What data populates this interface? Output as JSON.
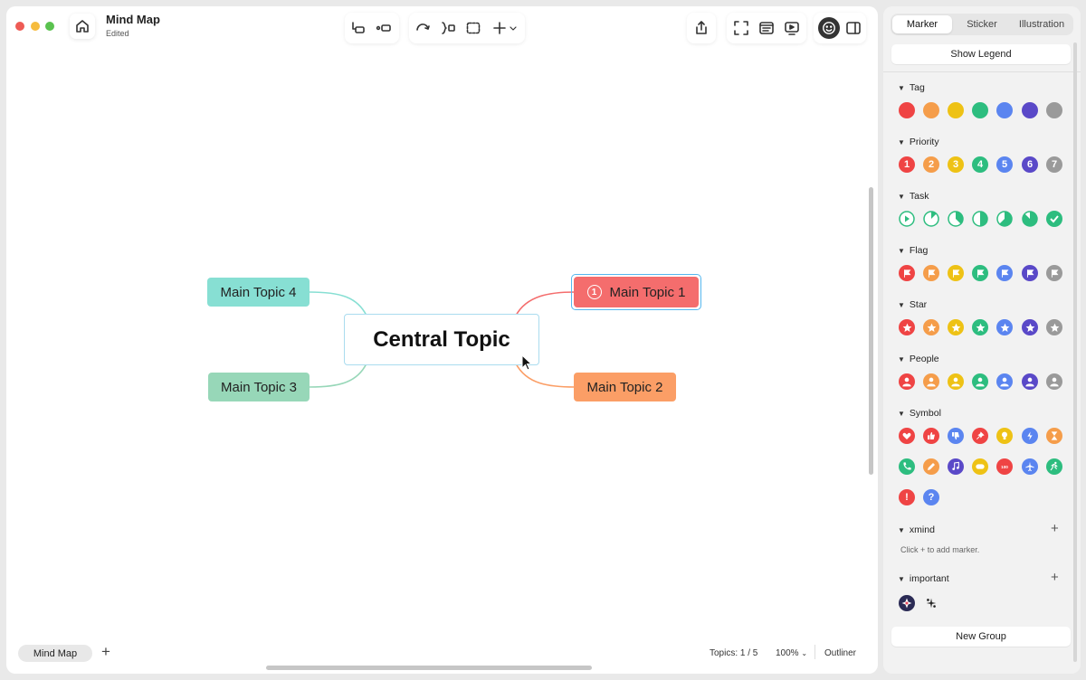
{
  "window": {
    "title": "Mind Map",
    "subtitle": "Edited"
  },
  "icons": {
    "home": "home-icon",
    "undo_group": [
      "topic-icon",
      "subtopic-icon"
    ],
    "relationship": "relationship-icon",
    "boundary": "boundary-icon",
    "summary": "summary-icon",
    "insert": "insert-icon",
    "share": "share-icon",
    "zen": "zen-mode-icon",
    "outline": "outline-icon",
    "present": "present-icon",
    "marker": "marker-icon",
    "panel_toggle": "panel-toggle-icon"
  },
  "map": {
    "central": "Central Topic",
    "topics": [
      {
        "label": "Main Topic 1",
        "color": "#f46d6d",
        "marker": "1"
      },
      {
        "label": "Main Topic 2",
        "color": "#fb9e66"
      },
      {
        "label": "Main Topic 3",
        "color": "#97d7b8"
      },
      {
        "label": "Main Topic 4",
        "color": "#87dfd3"
      }
    ]
  },
  "bottom": {
    "sheet_tab": "Mind Map",
    "add_sheet": "+",
    "topics_count": "Topics: 1 / 5",
    "zoom": "100%",
    "outliner": "Outliner"
  },
  "panel": {
    "tabs": [
      "Marker",
      "Sticker",
      "Illustration"
    ],
    "active_tab": "Marker",
    "show_legend": "Show Legend",
    "groups": [
      {
        "title": "Tag"
      },
      {
        "title": "Priority",
        "labels": [
          "1",
          "2",
          "3",
          "4",
          "5",
          "6",
          "7"
        ]
      },
      {
        "title": "Task"
      },
      {
        "title": "Flag"
      },
      {
        "title": "Star"
      },
      {
        "title": "People"
      },
      {
        "title": "Symbol"
      },
      {
        "title": "xmind",
        "hint": "Click + to add marker."
      },
      {
        "title": "important"
      }
    ],
    "plus": "+",
    "new_group": "New Group",
    "colors": [
      "#ef4444",
      "#f59d4a",
      "#eec215",
      "#2dbd7f",
      "#5b85f0",
      "#5a49c8",
      "#9a9a9a"
    ],
    "symbol_row1_colors": [
      "#ef4444",
      "#ef4444",
      "#5b85f0",
      "#ef4444",
      "#eec215",
      "#5b85f0",
      "#f59d4a"
    ],
    "symbol_row2_colors": [
      "#2dbd7f",
      "#f59d4a",
      "#5a49c8",
      "#eec215",
      "#ef4444",
      "#5b85f0",
      "#2dbd7f"
    ],
    "symbol_row3_colors": [
      "#ef4444",
      "#5b85f0"
    ],
    "symbol_row3_labels": [
      "!",
      "?"
    ]
  }
}
